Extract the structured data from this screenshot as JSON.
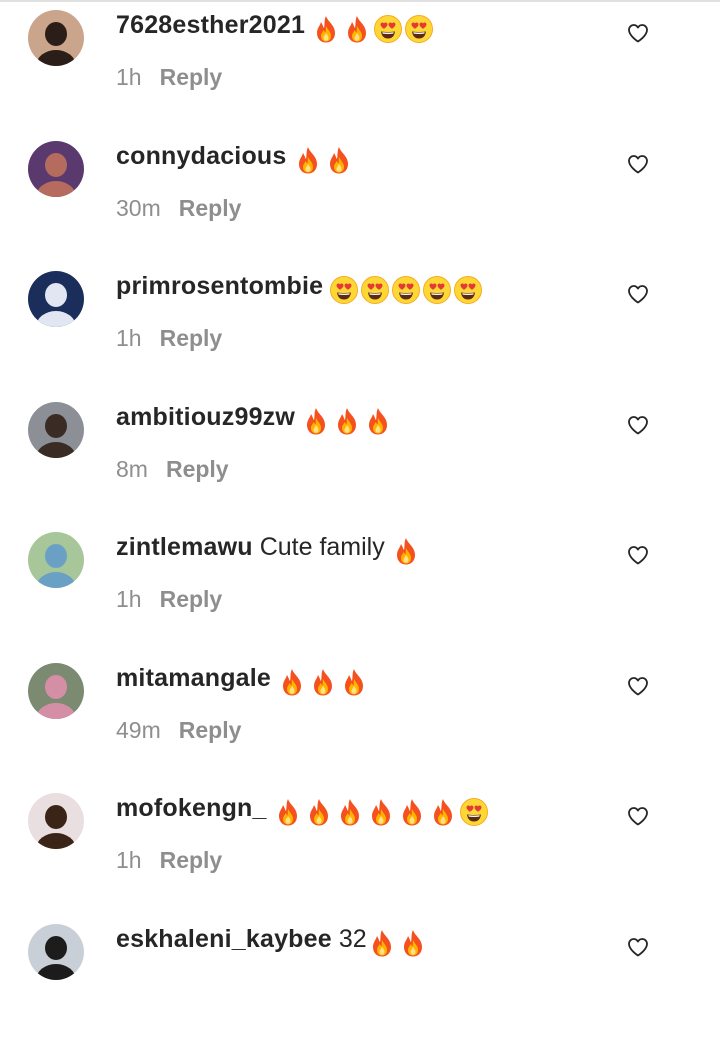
{
  "comments": [
    {
      "username": "7628esther2021",
      "text": "",
      "emojis": [
        "fire-emoji",
        "fire-emoji",
        "heart-eyes-emoji",
        "heart-eyes-emoji"
      ],
      "time": "1h",
      "reply_label": "Reply",
      "avatar_colors": [
        "#caa58c",
        "#2b1d18"
      ]
    },
    {
      "username": "connydacious",
      "text": "",
      "emojis": [
        "fire-emoji",
        "fire-emoji"
      ],
      "time": "30m",
      "reply_label": "Reply",
      "avatar_colors": [
        "#5a3a6e",
        "#b56b5e"
      ]
    },
    {
      "username": "primrosentombie",
      "text": "",
      "emojis": [
        "heart-eyes-emoji",
        "heart-eyes-emoji",
        "heart-eyes-emoji",
        "heart-eyes-emoji",
        "heart-eyes-emoji"
      ],
      "time": "1h",
      "reply_label": "Reply",
      "avatar_colors": [
        "#1b2d5a",
        "#e1e6f2"
      ]
    },
    {
      "username": "ambitiouz99zw",
      "text": "",
      "emojis": [
        "fire-emoji",
        "fire-emoji",
        "fire-emoji"
      ],
      "time": "8m",
      "reply_label": "Reply",
      "avatar_colors": [
        "#8c9096",
        "#3a2c24"
      ]
    },
    {
      "username": "zintlemawu",
      "text": "Cute family",
      "emojis": [
        "fire-emoji"
      ],
      "time": "1h",
      "reply_label": "Reply",
      "avatar_colors": [
        "#a7c79a",
        "#6aa0c4"
      ]
    },
    {
      "username": "mitamangale",
      "text": "",
      "emojis": [
        "fire-emoji",
        "fire-emoji",
        "fire-emoji"
      ],
      "time": "49m",
      "reply_label": "Reply",
      "avatar_colors": [
        "#7d8a72",
        "#d48fa6"
      ]
    },
    {
      "username": "mofokengn_",
      "text": "",
      "emojis": [
        "fire-emoji",
        "fire-emoji",
        "fire-emoji",
        "fire-emoji",
        "fire-emoji",
        "fire-emoji",
        "heart-eyes-emoji"
      ],
      "time": "1h",
      "reply_label": "Reply",
      "avatar_colors": [
        "#e9dfe0",
        "#3a2418"
      ]
    },
    {
      "username": "eskhaleni_kaybee",
      "text": "32",
      "emojis": [
        "fire-emoji",
        "fire-emoji"
      ],
      "time": "",
      "reply_label": "",
      "avatar_colors": [
        "#c8cfd6",
        "#1d1c1c"
      ]
    }
  ],
  "icons": {
    "like": "heart-outline-icon",
    "fire": "fire-emoji",
    "heart_eyes": "heart-eyes-emoji"
  },
  "colors": {
    "text_primary": "#262626",
    "text_secondary": "#8e8e8e",
    "background": "#ffffff"
  }
}
